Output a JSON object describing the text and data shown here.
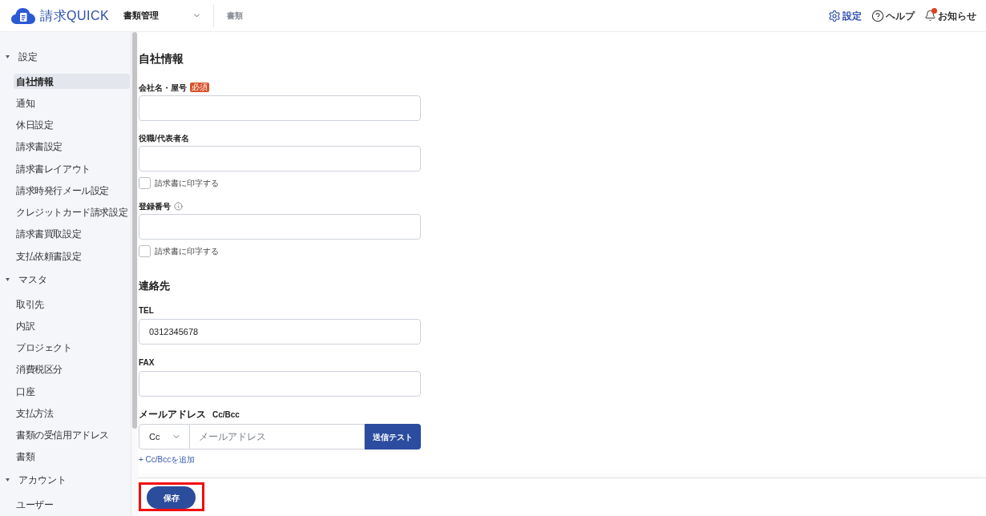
{
  "header": {
    "logo_text": "請求QUICK",
    "app_switcher": "書類管理",
    "section_link": "書類",
    "actions": [
      {
        "kind": "settings",
        "label": "設定",
        "selected": true
      },
      {
        "kind": "help",
        "label": "ヘルプ",
        "selected": false
      },
      {
        "kind": "notifications",
        "label": "お知らせ",
        "selected": false,
        "unread": true
      }
    ]
  },
  "sidebar": {
    "sections": [
      {
        "title": "設定",
        "expanded": true,
        "items": [
          {
            "label": "自社情報",
            "selected": true
          },
          {
            "label": "通知",
            "selected": false
          },
          {
            "label": "休日設定",
            "selected": false
          },
          {
            "label": "請求書設定",
            "selected": false
          },
          {
            "label": "請求書レイアウト",
            "selected": false
          },
          {
            "label": "請求時発行メール設定",
            "selected": false
          },
          {
            "label": "クレジットカード請求設定",
            "selected": false
          },
          {
            "label": "請求書買取設定",
            "selected": false
          },
          {
            "label": "支払依頼書設定",
            "selected": false
          }
        ]
      },
      {
        "title": "マスタ",
        "expanded": true,
        "items": [
          {
            "label": "取引先",
            "selected": false
          },
          {
            "label": "内訳",
            "selected": false
          },
          {
            "label": "プロジェクト",
            "selected": false
          },
          {
            "label": "消費税区分",
            "selected": false
          },
          {
            "label": "口座",
            "selected": false
          },
          {
            "label": "支払方法",
            "selected": false
          },
          {
            "label": "書類の受信用アドレス",
            "selected": false
          },
          {
            "label": "書類",
            "selected": false
          }
        ]
      },
      {
        "title": "アカウント",
        "expanded": true,
        "items": [
          {
            "label": "ユーザー",
            "selected": false
          }
        ]
      }
    ]
  },
  "company_section": {
    "title": "自社情報",
    "fields": [
      {
        "label": "会社名・屋号",
        "badge": "必須"
      },
      {
        "label": "役職/代表者名",
        "print_option": {
          "label": "請求書に印字する",
          "checked": false
        }
      },
      {
        "label": "登録番号",
        "info": true,
        "print_option": {
          "label": "請求書に印字する",
          "checked": false
        }
      }
    ]
  },
  "contact_section": {
    "title": "連絡先",
    "fields": [
      {
        "label": "TEL",
        "value": "0312345678"
      },
      {
        "label": "FAX"
      }
    ],
    "email": {
      "label": "メールアドレス",
      "sublabel": "Cc/Bcc",
      "cc_select": "Cc",
      "placeholder": "メールアドレス",
      "test_button": "送信テスト",
      "add_link": "+ Cc/Bccを追加"
    }
  },
  "footer": {
    "save_button": {
      "label": "保存",
      "highlighted": true
    }
  }
}
